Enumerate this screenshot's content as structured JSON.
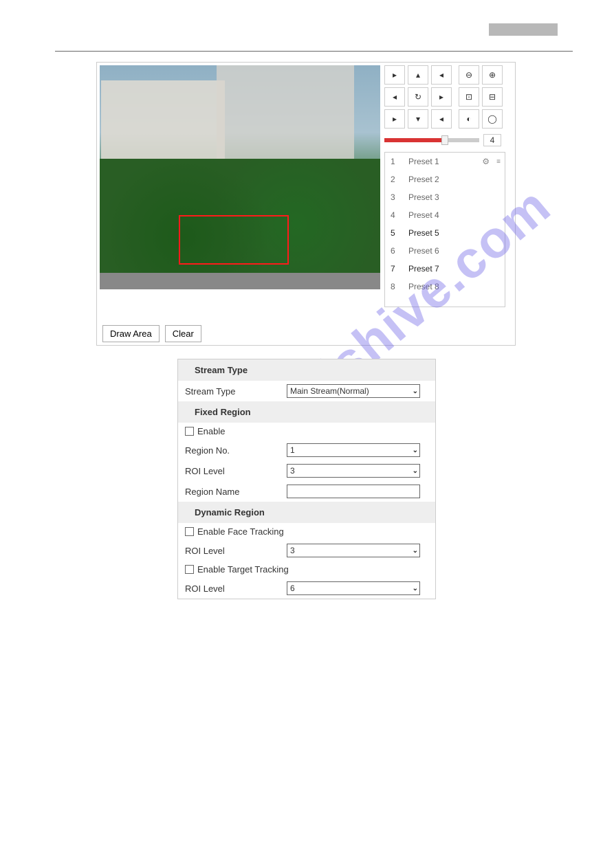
{
  "panel_buttons": {
    "draw_area": "Draw Area",
    "clear": "Clear"
  },
  "ptz": {
    "slider_value": "4",
    "presets": [
      {
        "num": "1",
        "label": "Preset 1"
      },
      {
        "num": "2",
        "label": "Preset 2"
      },
      {
        "num": "3",
        "label": "Preset 3"
      },
      {
        "num": "4",
        "label": "Preset 4"
      },
      {
        "num": "5",
        "label": "Preset 5"
      },
      {
        "num": "6",
        "label": "Preset 6"
      },
      {
        "num": "7",
        "label": "Preset 7"
      },
      {
        "num": "8",
        "label": "Preset 8"
      }
    ]
  },
  "form": {
    "section_stream": "Stream Type",
    "stream_type_label": "Stream Type",
    "stream_type_value": "Main Stream(Normal)",
    "section_fixed": "Fixed Region",
    "enable_label": "Enable",
    "region_no_label": "Region No.",
    "region_no_value": "1",
    "roi_level_label": "ROI Level",
    "roi_level_fixed_value": "3",
    "region_name_label": "Region Name",
    "region_name_value": "",
    "section_dynamic": "Dynamic Region",
    "enable_face_label": "Enable Face Tracking",
    "roi_level_face_value": "3",
    "enable_target_label": "Enable Target Tracking",
    "roi_level_target_value": "6"
  },
  "watermark": "manualshive.com"
}
